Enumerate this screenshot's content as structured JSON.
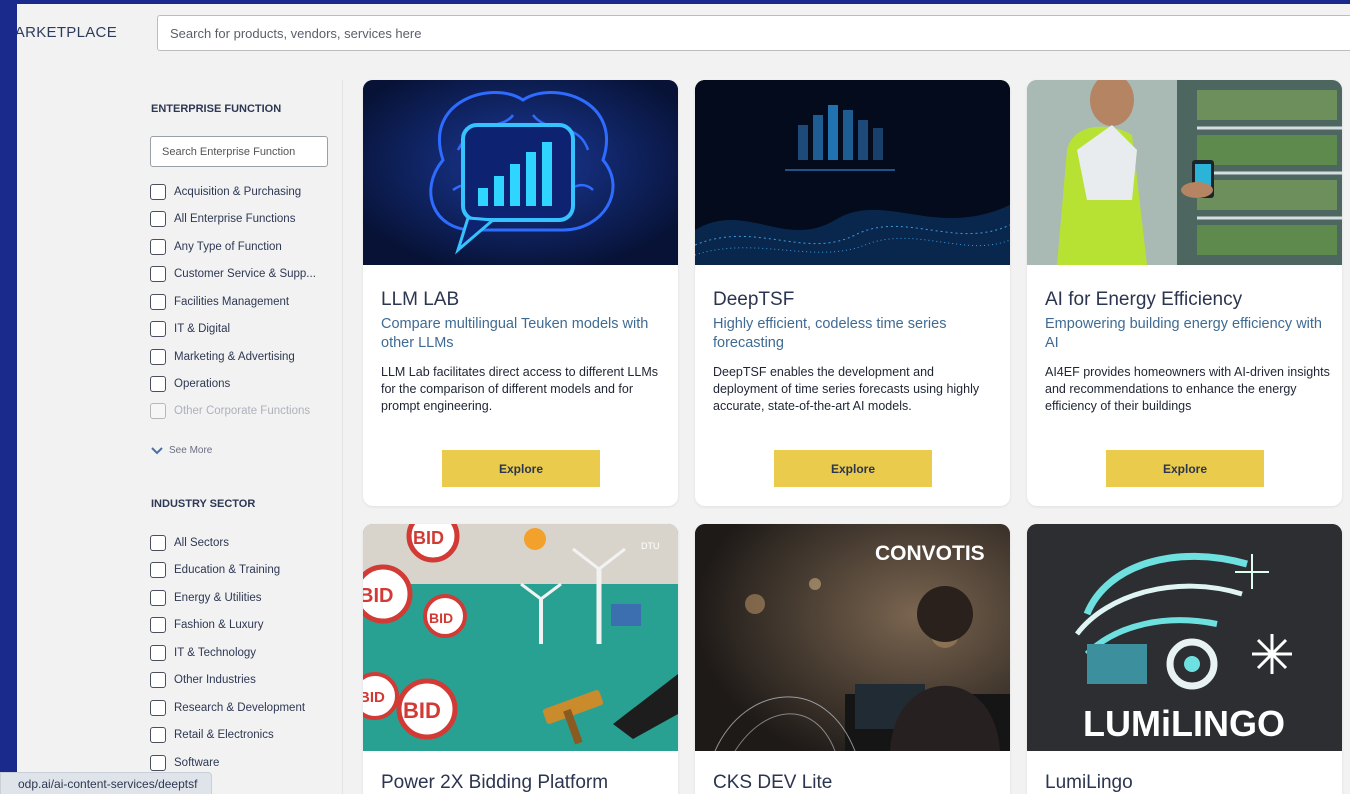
{
  "header": {
    "brand": "MARKETPLACE",
    "search_placeholder": "Search for products, vendors, services here"
  },
  "sidebar": {
    "enterprise_title": "ENTERPRISE FUNCTION",
    "enterprise_search_placeholder": "Search Enterprise Function",
    "enterprise_items": [
      "Acquisition & Purchasing",
      "All Enterprise Functions",
      "Any Type of Function",
      "Customer Service & Supp...",
      "Facilities Management",
      "IT & Digital",
      "Marketing & Advertising",
      "Operations",
      "Other Corporate Functions"
    ],
    "see_more": "See More",
    "industry_title": "INDUSTRY SECTOR",
    "industry_items": [
      "All Sectors",
      "Education & Training",
      "Energy & Utilities",
      "Fashion & Luxury",
      "IT & Technology",
      "Other Industries",
      "Research & Development",
      "Retail & Electronics",
      "Software"
    ]
  },
  "cards": [
    {
      "title": "LLM LAB",
      "subtitle": "Compare multilingual Teuken models with other LLMs",
      "description": "LLM Lab facilitates direct access to different LLMs for the comparison of different models and for prompt engineering.",
      "button": "Explore"
    },
    {
      "title": "DeepTSF",
      "subtitle": "Highly efficient, codeless time series forecasting",
      "description": "DeepTSF enables the development and deployment of time series forecasts using highly accurate, state-of-the-art AI models.",
      "button": "Explore"
    },
    {
      "title": "AI for Energy Efficiency",
      "subtitle": "Empowering building energy efficiency with AI",
      "description": "AI4EF provides homeowners with AI-driven insights and recommendations to enhance the energy efficiency of their buildings",
      "button": "Explore"
    },
    {
      "title": "Power 2X Bidding Platform",
      "image_text": [
        "BID",
        "BID",
        "BID",
        "BID",
        "BID",
        "DTU"
      ]
    },
    {
      "title": "CKS DEV Lite",
      "image_text": "CONVOTIS"
    },
    {
      "title": "LumiLingo",
      "image_text": "LUMiLINGO"
    }
  ],
  "status_bar": {
    "url": "odp.ai/ai-content-services/deeptsf"
  },
  "colors": {
    "frame_border": "#1a2a8c",
    "button": "#ebcb4c",
    "subtitle": "#3f6b93",
    "title": "#2c3550"
  }
}
